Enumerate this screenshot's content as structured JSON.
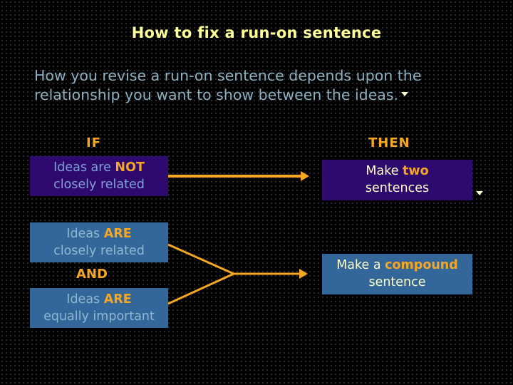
{
  "title": "How to fix a run-on sentence",
  "intro": {
    "text": "How you revise a run-on sentence depends upon the relationship you want to show between the ideas.",
    "marker_icon": "triangle-down-icon"
  },
  "headers": {
    "if": "IF",
    "then": "THEN"
  },
  "rows": [
    {
      "condition": {
        "pre": "Ideas are ",
        "emphasis": "NOT",
        "post": "closely related"
      },
      "result": {
        "pre": "Make ",
        "emphasis": "two",
        "post": "sentences"
      }
    },
    {
      "conditions": [
        {
          "pre": "Ideas ",
          "emphasis": "ARE",
          "post": "closely related"
        },
        {
          "pre": "Ideas ",
          "emphasis": "ARE",
          "post": "equally important"
        }
      ],
      "joiner": "AND",
      "result": {
        "pre": "Make a ",
        "emphasis": "compound",
        "post": "sentence"
      }
    }
  ],
  "colors": {
    "background": "#000000",
    "title": "#ffff99",
    "accent": "#f5a623",
    "purple_box": "#2e0a6e",
    "blue_box": "#336699",
    "intro_text": "#8db0c0"
  }
}
